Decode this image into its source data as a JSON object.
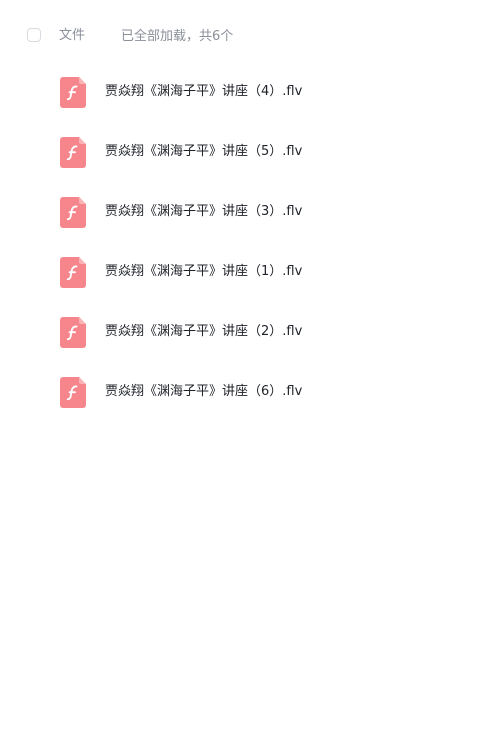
{
  "header": {
    "column_label": "文件",
    "status_text": "已全部加载，共6个"
  },
  "files": [
    {
      "name": "贾焱翔《渊海子平》讲座（4）.flv",
      "icon": "flash-video-file-icon"
    },
    {
      "name": "贾焱翔《渊海子平》讲座（5）.flv",
      "icon": "flash-video-file-icon"
    },
    {
      "name": "贾焱翔《渊海子平》讲座（3）.flv",
      "icon": "flash-video-file-icon"
    },
    {
      "name": "贾焱翔《渊海子平》讲座（1）.flv",
      "icon": "flash-video-file-icon"
    },
    {
      "name": "贾焱翔《渊海子平》讲座（2）.flv",
      "icon": "flash-video-file-icon"
    },
    {
      "name": "贾焱翔《渊海子平》讲座（6）.flv",
      "icon": "flash-video-file-icon"
    }
  ],
  "colors": {
    "file_icon": "#f7868c",
    "muted_text": "#8a8f99",
    "primary_text": "#1f2329"
  }
}
